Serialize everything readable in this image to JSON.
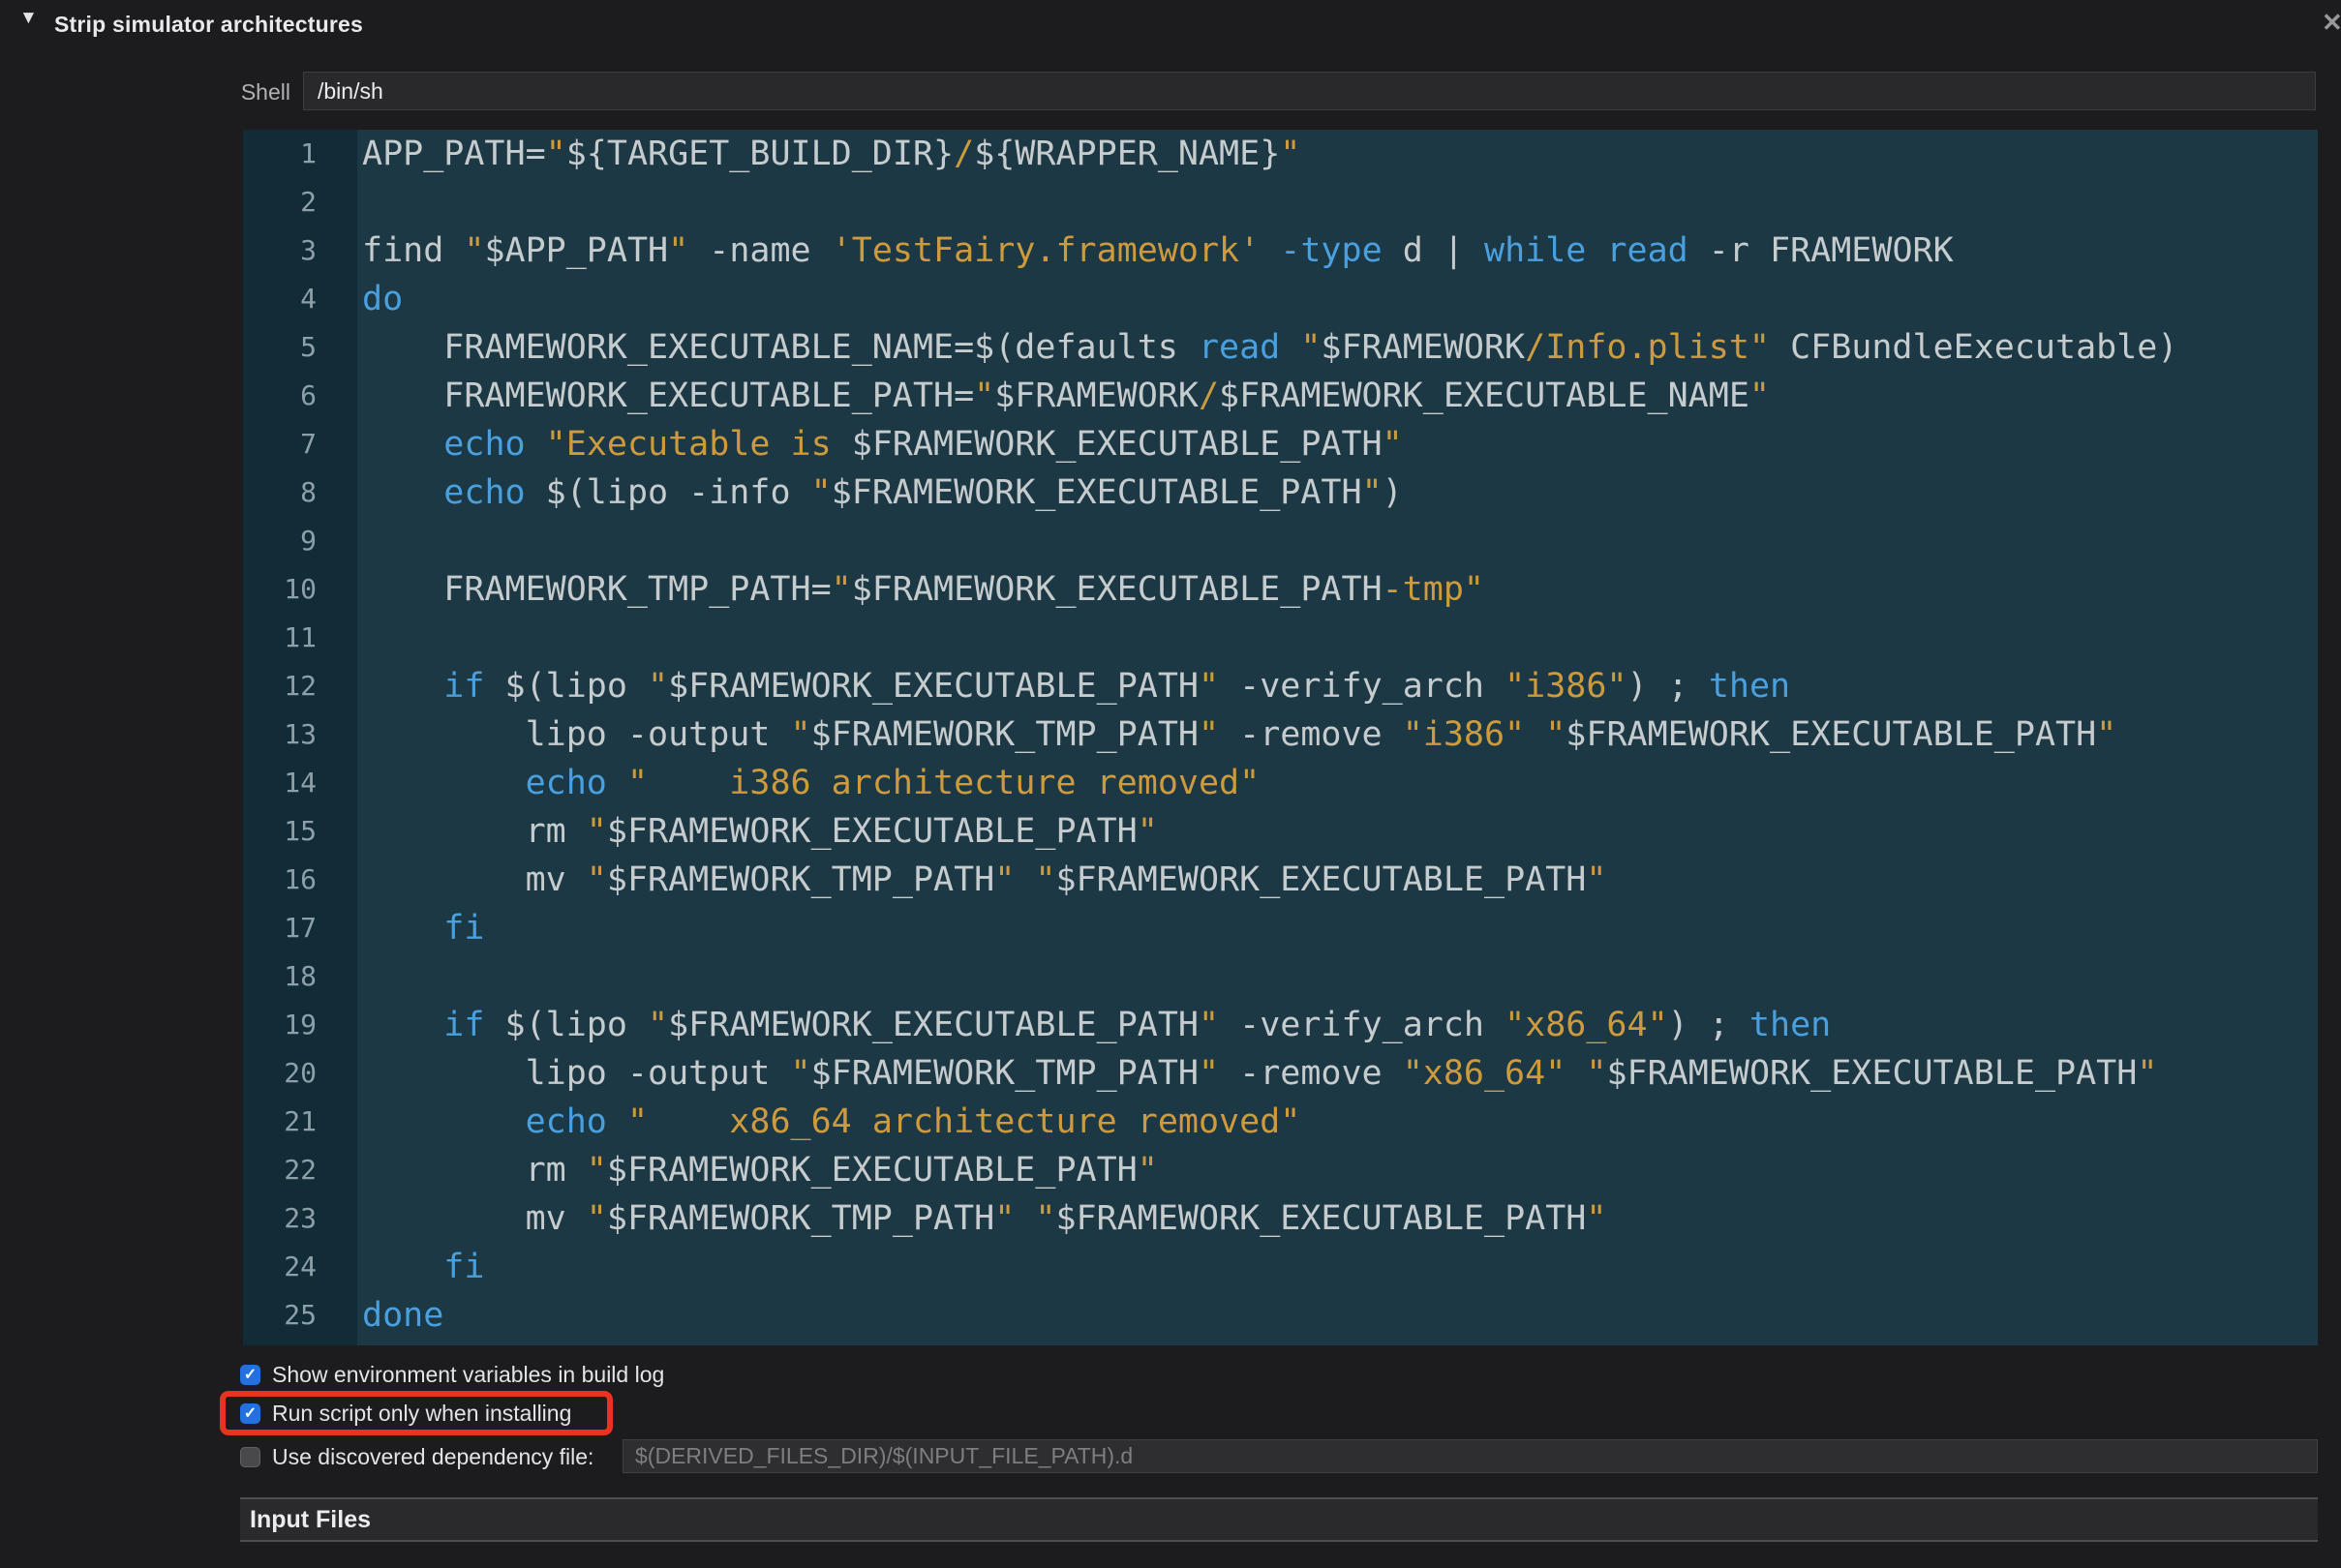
{
  "header": {
    "title": "Strip simulator architectures",
    "disclosure_icon": "▼",
    "close_icon": "✕"
  },
  "shell": {
    "label": "Shell",
    "value": "/bin/sh"
  },
  "editor": {
    "language": "shell-script",
    "lines": [
      {
        "n": "1",
        "t": [
          [
            "p",
            "APP_PATH="
          ],
          [
            "s",
            "\""
          ],
          [
            "p",
            "${TARGET_BUILD_DIR}"
          ],
          [
            "s",
            "/"
          ],
          [
            "p",
            "${WRAPPER_NAME}"
          ],
          [
            "s",
            "\""
          ]
        ]
      },
      {
        "n": "2",
        "t": []
      },
      {
        "n": "3",
        "t": [
          [
            "p",
            "find "
          ],
          [
            "s",
            "\""
          ],
          [
            "p",
            "$APP_PATH"
          ],
          [
            "s",
            "\""
          ],
          [
            "p",
            " -name "
          ],
          [
            "s",
            "'TestFairy.framework'"
          ],
          [
            "p",
            " "
          ],
          [
            "k",
            "-type"
          ],
          [
            "p",
            " d | "
          ],
          [
            "k",
            "while"
          ],
          [
            "p",
            " "
          ],
          [
            "k",
            "read"
          ],
          [
            "p",
            " -r FRAMEWORK"
          ]
        ]
      },
      {
        "n": "4",
        "t": [
          [
            "k",
            "do"
          ]
        ]
      },
      {
        "n": "5",
        "t": [
          [
            "p",
            "    FRAMEWORK_EXECUTABLE_NAME=$(defaults "
          ],
          [
            "k",
            "read"
          ],
          [
            "p",
            " "
          ],
          [
            "s",
            "\""
          ],
          [
            "p",
            "$FRAMEWORK"
          ],
          [
            "s",
            "/Info.plist\""
          ],
          [
            "p",
            " CFBundleExecutable)"
          ]
        ]
      },
      {
        "n": "6",
        "t": [
          [
            "p",
            "    FRAMEWORK_EXECUTABLE_PATH="
          ],
          [
            "s",
            "\""
          ],
          [
            "p",
            "$FRAMEWORK"
          ],
          [
            "s",
            "/"
          ],
          [
            "p",
            "$FRAMEWORK_EXECUTABLE_NAME"
          ],
          [
            "s",
            "\""
          ]
        ]
      },
      {
        "n": "7",
        "t": [
          [
            "p",
            "    "
          ],
          [
            "k",
            "echo"
          ],
          [
            "p",
            " "
          ],
          [
            "s",
            "\"Executable is "
          ],
          [
            "p",
            "$FRAMEWORK_EXECUTABLE_PATH"
          ],
          [
            "s",
            "\""
          ]
        ]
      },
      {
        "n": "8",
        "t": [
          [
            "p",
            "    "
          ],
          [
            "k",
            "echo"
          ],
          [
            "p",
            " $(lipo -info "
          ],
          [
            "s",
            "\""
          ],
          [
            "p",
            "$FRAMEWORK_EXECUTABLE_PATH"
          ],
          [
            "s",
            "\""
          ],
          [
            "p",
            ")"
          ]
        ]
      },
      {
        "n": "9",
        "t": []
      },
      {
        "n": "10",
        "t": [
          [
            "p",
            "    FRAMEWORK_TMP_PATH="
          ],
          [
            "s",
            "\""
          ],
          [
            "p",
            "$FRAMEWORK_EXECUTABLE_PATH"
          ],
          [
            "s",
            "-tmp\""
          ]
        ]
      },
      {
        "n": "11",
        "t": []
      },
      {
        "n": "12",
        "t": [
          [
            "p",
            "    "
          ],
          [
            "k",
            "if"
          ],
          [
            "p",
            " $(lipo "
          ],
          [
            "s",
            "\""
          ],
          [
            "p",
            "$FRAMEWORK_EXECUTABLE_PATH"
          ],
          [
            "s",
            "\""
          ],
          [
            "p",
            " -verify_arch "
          ],
          [
            "s",
            "\"i386\""
          ],
          [
            "p",
            ") ; "
          ],
          [
            "k",
            "then"
          ]
        ]
      },
      {
        "n": "13",
        "t": [
          [
            "p",
            "        lipo -output "
          ],
          [
            "s",
            "\""
          ],
          [
            "p",
            "$FRAMEWORK_TMP_PATH"
          ],
          [
            "s",
            "\""
          ],
          [
            "p",
            " -remove "
          ],
          [
            "s",
            "\"i386\""
          ],
          [
            "p",
            " "
          ],
          [
            "s",
            "\""
          ],
          [
            "p",
            "$FRAMEWORK_EXECUTABLE_PATH"
          ],
          [
            "s",
            "\""
          ]
        ]
      },
      {
        "n": "14",
        "t": [
          [
            "p",
            "        "
          ],
          [
            "k",
            "echo"
          ],
          [
            "p",
            " "
          ],
          [
            "s",
            "\"    i386 architecture removed\""
          ]
        ]
      },
      {
        "n": "15",
        "t": [
          [
            "p",
            "        rm "
          ],
          [
            "s",
            "\""
          ],
          [
            "p",
            "$FRAMEWORK_EXECUTABLE_PATH"
          ],
          [
            "s",
            "\""
          ]
        ]
      },
      {
        "n": "16",
        "t": [
          [
            "p",
            "        mv "
          ],
          [
            "s",
            "\""
          ],
          [
            "p",
            "$FRAMEWORK_TMP_PATH"
          ],
          [
            "s",
            "\""
          ],
          [
            "p",
            " "
          ],
          [
            "s",
            "\""
          ],
          [
            "p",
            "$FRAMEWORK_EXECUTABLE_PATH"
          ],
          [
            "s",
            "\""
          ]
        ]
      },
      {
        "n": "17",
        "t": [
          [
            "p",
            "    "
          ],
          [
            "k",
            "fi"
          ]
        ]
      },
      {
        "n": "18",
        "t": []
      },
      {
        "n": "19",
        "t": [
          [
            "p",
            "    "
          ],
          [
            "k",
            "if"
          ],
          [
            "p",
            " $(lipo "
          ],
          [
            "s",
            "\""
          ],
          [
            "p",
            "$FRAMEWORK_EXECUTABLE_PATH"
          ],
          [
            "s",
            "\""
          ],
          [
            "p",
            " -verify_arch "
          ],
          [
            "s",
            "\"x86_64\""
          ],
          [
            "p",
            ") ; "
          ],
          [
            "k",
            "then"
          ]
        ]
      },
      {
        "n": "20",
        "t": [
          [
            "p",
            "        lipo -output "
          ],
          [
            "s",
            "\""
          ],
          [
            "p",
            "$FRAMEWORK_TMP_PATH"
          ],
          [
            "s",
            "\""
          ],
          [
            "p",
            " -remove "
          ],
          [
            "s",
            "\"x86_64\""
          ],
          [
            "p",
            " "
          ],
          [
            "s",
            "\""
          ],
          [
            "p",
            "$FRAMEWORK_EXECUTABLE_PATH"
          ],
          [
            "s",
            "\""
          ]
        ]
      },
      {
        "n": "21",
        "t": [
          [
            "p",
            "        "
          ],
          [
            "k",
            "echo"
          ],
          [
            "p",
            " "
          ],
          [
            "s",
            "\"    x86_64 architecture removed\""
          ]
        ]
      },
      {
        "n": "22",
        "t": [
          [
            "p",
            "        rm "
          ],
          [
            "s",
            "\""
          ],
          [
            "p",
            "$FRAMEWORK_EXECUTABLE_PATH"
          ],
          [
            "s",
            "\""
          ]
        ]
      },
      {
        "n": "23",
        "t": [
          [
            "p",
            "        mv "
          ],
          [
            "s",
            "\""
          ],
          [
            "p",
            "$FRAMEWORK_TMP_PATH"
          ],
          [
            "s",
            "\""
          ],
          [
            "p",
            " "
          ],
          [
            "s",
            "\""
          ],
          [
            "p",
            "$FRAMEWORK_EXECUTABLE_PATH"
          ],
          [
            "s",
            "\""
          ]
        ]
      },
      {
        "n": "24",
        "t": [
          [
            "p",
            "    "
          ],
          [
            "k",
            "fi"
          ]
        ]
      },
      {
        "n": "25",
        "t": [
          [
            "k",
            "done"
          ]
        ]
      }
    ]
  },
  "options": {
    "show_env": {
      "label": "Show environment variables in build log",
      "checked": true
    },
    "run_install": {
      "label": "Run script only when installing",
      "checked": true
    },
    "dependency": {
      "label": "Use discovered dependency file:",
      "checked": false,
      "placeholder": "$(DERIVED_FILES_DIR)/$(INPUT_FILE_PATH).d"
    }
  },
  "sections": {
    "input_files": "Input Files"
  },
  "glyphs": {
    "check": "✓"
  },
  "colors": {
    "page_bg": "#1c1c1e",
    "editor_bg": "#1b3844",
    "gutter_bg": "#122c37",
    "code_plain": "#c6cbcd",
    "code_keyword": "#4aa0de",
    "code_string": "#cd9b3d",
    "line_number": "#8da0a9",
    "checkbox_checked_blue": "#2470e1",
    "annotation_red": "#e8341f"
  }
}
